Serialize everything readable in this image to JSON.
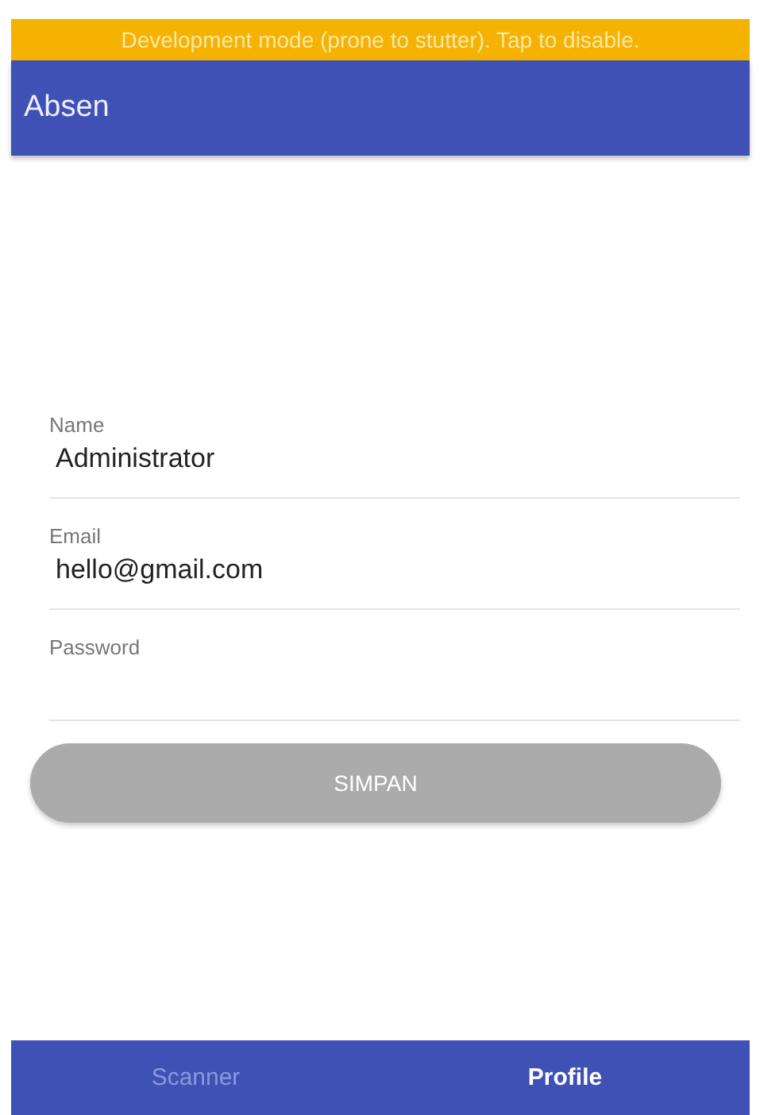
{
  "dev_banner": {
    "text": "Development mode (prone to stutter). Tap to disable."
  },
  "app_bar": {
    "title": "Absen"
  },
  "fields": [
    {
      "label": "Name",
      "value": "Administrator"
    },
    {
      "label": "Email",
      "value": "hello@gmail.com"
    },
    {
      "label": "Password"
    }
  ],
  "save_button": {
    "label": "SIMPAN",
    "disabled": true
  },
  "tabs": [
    {
      "label": "Scanner",
      "selected": false
    },
    {
      "label": "Profile",
      "selected": true
    }
  ]
}
